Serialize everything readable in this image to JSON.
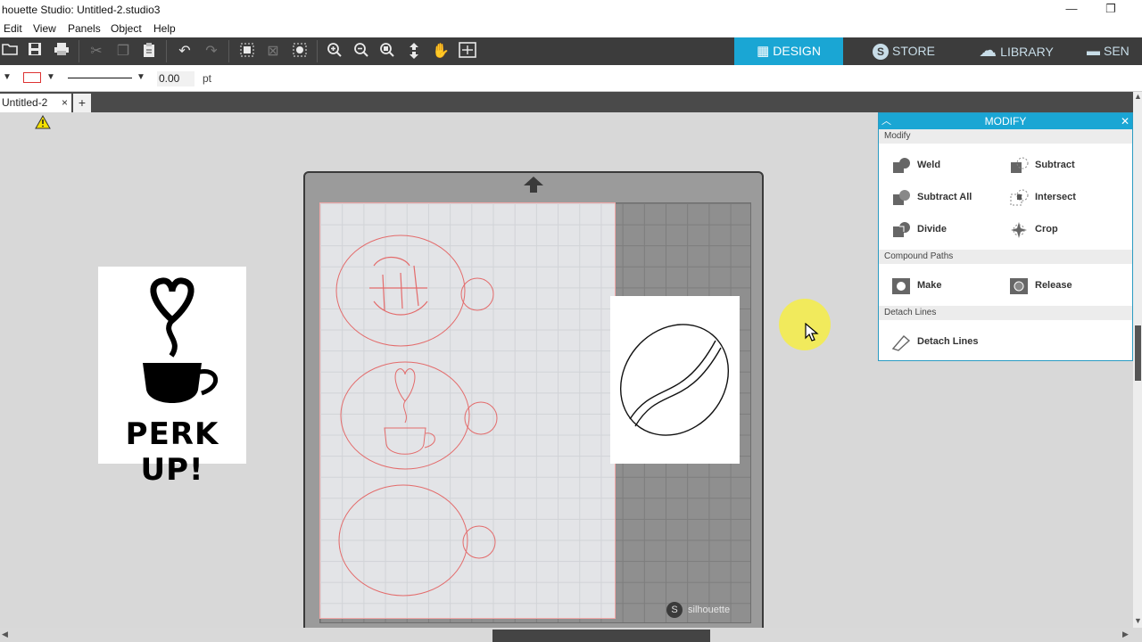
{
  "window": {
    "title": "houette Studio: Untitled-2.studio3",
    "minimize": "—",
    "restore": "❐"
  },
  "menu": {
    "items": [
      "Edit",
      "View",
      "Panels",
      "Object",
      "Help"
    ]
  },
  "toolbar": {
    "tabs": [
      {
        "label": "DESIGN",
        "icon": "grid-icon",
        "glyph": "▦",
        "active": true
      },
      {
        "label": "STORE",
        "icon": "silhouette-s-icon",
        "glyph": "S",
        "active": false
      },
      {
        "label": "LIBRARY",
        "icon": "cloud-icon",
        "glyph": "☁",
        "active": false
      },
      {
        "label": "SEN",
        "icon": "send-icon",
        "glyph": "▬",
        "active": false
      }
    ]
  },
  "stylebar": {
    "line_width": "0.00",
    "unit": "pt"
  },
  "doc_tabs": {
    "current": "Untitled-2",
    "close": "×",
    "add": "+"
  },
  "canvas": {
    "brand": "silhouette",
    "perk_text": "PERK UP!"
  },
  "modify_panel": {
    "title": "MODIFY",
    "sections": [
      {
        "label": "Modify",
        "buttons": [
          "Weld",
          "Subtract",
          "Subtract All",
          "Intersect",
          "Divide",
          "Crop"
        ]
      },
      {
        "label": "Compound Paths",
        "buttons": [
          "Make",
          "Release"
        ]
      },
      {
        "label": "Detach Lines",
        "buttons": [
          "Detach Lines"
        ]
      }
    ]
  },
  "colors": {
    "accent": "#1aa6d4",
    "toolbar_bg": "#3c3c3c",
    "cut_line": "#e36b6b",
    "highlight": "#f3ec51"
  }
}
